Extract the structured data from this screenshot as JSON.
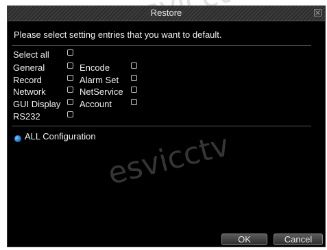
{
  "dialog": {
    "title": "Restore",
    "close_icon": "close-icon",
    "prompt": "Please select setting entries that you want to default."
  },
  "options": [
    {
      "label": "Select all",
      "checked": false
    },
    {
      "label": "General",
      "checked": false
    },
    {
      "label": "Encode",
      "checked": false
    },
    {
      "label": "Record",
      "checked": false
    },
    {
      "label": "Alarm Set",
      "checked": false
    },
    {
      "label": "Network",
      "checked": false
    },
    {
      "label": "NetService",
      "checked": false
    },
    {
      "label": "GUI Display",
      "checked": false
    },
    {
      "label": "Account",
      "checked": false
    },
    {
      "label": "RS232",
      "checked": false
    }
  ],
  "all_config": {
    "label": "ALL Configuration",
    "icon": "radio-dot-icon",
    "color": "#2a8be0"
  },
  "buttons": {
    "ok": "OK",
    "cancel": "Cancel"
  },
  "watermark": "esvicctv",
  "colors": {
    "background": "#000000",
    "text": "#f0f0f0",
    "accent": "#2a8be0"
  }
}
